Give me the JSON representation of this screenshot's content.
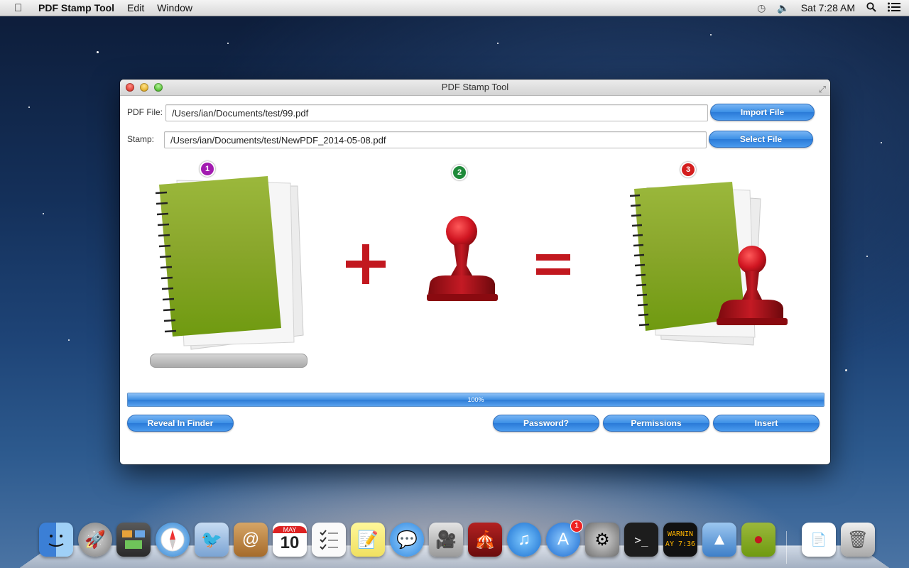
{
  "menubar": {
    "app_name": "PDF Stamp Tool",
    "menus": [
      "Edit",
      "Window"
    ],
    "clock": "Sat 7:28 AM"
  },
  "window": {
    "title": "PDF Stamp Tool",
    "pdf_file_label": "PDF File:",
    "pdf_file_value": "/Users/ian/Documents/test/99.pdf",
    "stamp_label": "Stamp:",
    "stamp_value": "/Users/ian/Documents/test/NewPDF_2014-05-08.pdf",
    "import_button": "Import File",
    "select_button": "Select File",
    "steps": [
      "1",
      "2",
      "3"
    ],
    "step_colors": [
      "#a21bb0",
      "#1f8a3a",
      "#d41e1e"
    ],
    "operator_plus": "+",
    "operator_equals": "=",
    "progress_percent": 100,
    "progress_text": "100%",
    "reveal_button": "Reveal In Finder",
    "password_button": "Password?",
    "permissions_button": "Permissions",
    "insert_button": "Insert"
  },
  "dock": {
    "calendar_month": "MAY",
    "calendar_day": "10",
    "app_store_badge": "1",
    "console_text": "WARNIN",
    "console_text2": "AY 7:36"
  }
}
